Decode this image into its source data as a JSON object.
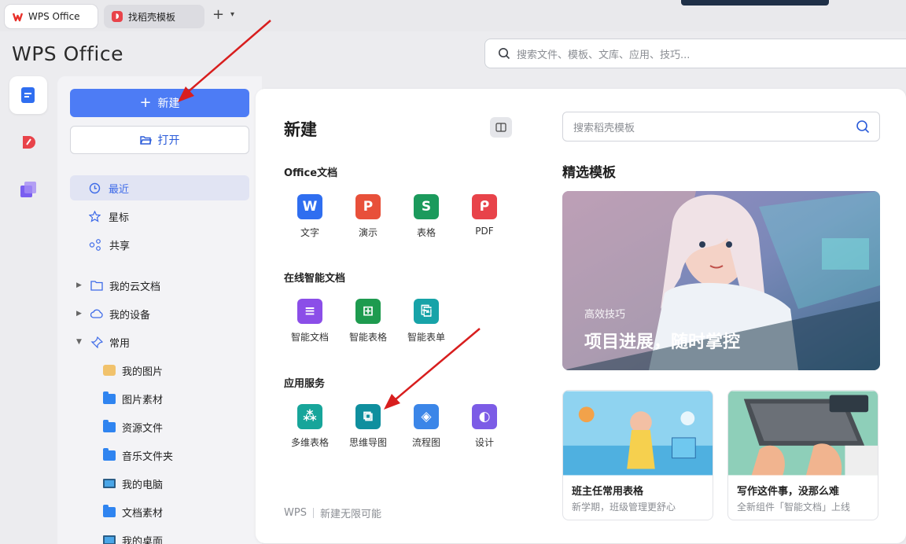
{
  "tabs": [
    {
      "label": "WPS Office",
      "active": true
    },
    {
      "label": "找稻壳模板",
      "active": false
    }
  ],
  "brand": "WPS Office",
  "global_search": {
    "placeholder": "搜索文件、模板、文库、应用、技巧..."
  },
  "nav": {
    "new_label": "新建",
    "open_label": "打开",
    "items": [
      {
        "label": "最近",
        "icon": "clock-icon",
        "selected": true
      },
      {
        "label": "星标",
        "icon": "star-icon",
        "selected": false
      },
      {
        "label": "共享",
        "icon": "share-icon",
        "selected": false
      }
    ],
    "tree": [
      {
        "label": "我的云文档",
        "icon": "cloud-folder-icon",
        "expanded": false
      },
      {
        "label": "我的设备",
        "icon": "cloud-device-icon",
        "expanded": false
      },
      {
        "label": "常用",
        "icon": "pin-icon",
        "expanded": true
      }
    ],
    "common": [
      {
        "label": "我的图片",
        "icon": "picture-folder-icon"
      },
      {
        "label": "图片素材",
        "icon": "folder-icon"
      },
      {
        "label": "资源文件",
        "icon": "folder-icon"
      },
      {
        "label": "音乐文件夹",
        "icon": "folder-icon"
      },
      {
        "label": "我的电脑",
        "icon": "computer-icon"
      },
      {
        "label": "文档素材",
        "icon": "folder-icon"
      },
      {
        "label": "我的桌面",
        "icon": "desktop-icon"
      }
    ]
  },
  "main": {
    "title": "新建",
    "sections": [
      {
        "title": "Office文档",
        "apps": [
          {
            "label": "文字",
            "glyph": "W",
            "color": "#2f6ef0"
          },
          {
            "label": "演示",
            "glyph": "P",
            "color": "#e8503a"
          },
          {
            "label": "表格",
            "glyph": "S",
            "color": "#1b9a5c"
          },
          {
            "label": "PDF",
            "glyph": "ᑭ",
            "color": "#e8434a"
          }
        ]
      },
      {
        "title": "在线智能文档",
        "apps": [
          {
            "label": "智能文档",
            "glyph": "≡",
            "color": "#8b4ee8"
          },
          {
            "label": "智能表格",
            "glyph": "⊞",
            "color": "#1e9b4f"
          },
          {
            "label": "智能表单",
            "glyph": "⎘",
            "color": "#17a3a8"
          }
        ]
      },
      {
        "title": "应用服务",
        "apps": [
          {
            "label": "多维表格",
            "glyph": "⁂",
            "color": "#17a59a"
          },
          {
            "label": "思维导图",
            "glyph": "⧉",
            "color": "#0f8f9e"
          },
          {
            "label": "流程图",
            "glyph": "◈",
            "color": "#3b86e8"
          },
          {
            "label": "设计",
            "glyph": "◐",
            "color": "#7c5ce6"
          }
        ]
      }
    ],
    "footer_brand": "WPS",
    "footer_slogan": "新建无限可能"
  },
  "templates": {
    "search_placeholder": "搜索稻壳模板",
    "title": "精选模板",
    "banner_tag": "高效技巧",
    "banner_headline": "项目进展，随时掌控",
    "cards": [
      {
        "title": "班主任常用表格",
        "subtitle": "新学期，班级管理更舒心"
      },
      {
        "title": "写作这件事，没那么难",
        "subtitle": "全新组件「智能文档」上线"
      }
    ]
  },
  "colors": {
    "accent": "#4d7cf5",
    "arrow": "#d81e1e"
  }
}
